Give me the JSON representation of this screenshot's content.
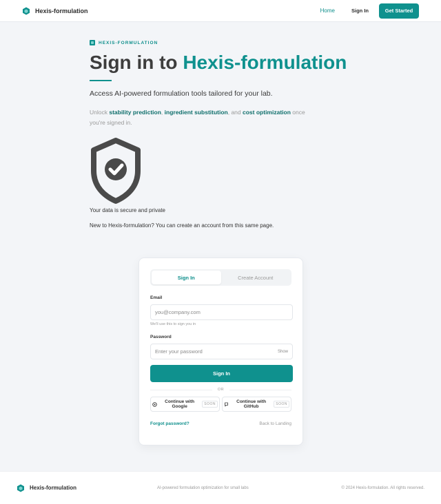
{
  "header": {
    "brand": "Hexis-formulation",
    "nav_home": "Home",
    "nav_signin": "Sign In",
    "nav_cta": "Get Started"
  },
  "hero": {
    "eyebrow": "HEXIS-FORMULATION",
    "title_prefix": "Sign in to ",
    "title_accent": "Hexis-formulation",
    "lead": "Access AI-powered formulation tools tailored for your lab.",
    "sub_1": "Unlock ",
    "sub_b1": "stability prediction",
    "sub_2": ", ",
    "sub_b2": "ingredient substitution",
    "sub_3": ", and ",
    "sub_b3": "cost optimization",
    "sub_4": " once you're signed in.",
    "secure_text": "Your data is secure and private",
    "new_to": "New to Hexis-formulation? You can create an account from this same page."
  },
  "card": {
    "tab_signin": "Sign In",
    "tab_create": "Create Account",
    "email_label": "Email",
    "email_placeholder": "you@company.com",
    "email_hint": "We'll use this to sign you in",
    "password_label": "Password",
    "password_placeholder": "Enter your password",
    "show_label": "Show",
    "submit_label": "Sign In",
    "or_label": "OR",
    "google_label": "Continue with Google",
    "github_label": "Continue with GitHub",
    "soon_label": "SOON",
    "forgot_label": "Forgot password?",
    "back_label": "Back to Landing"
  },
  "footer": {
    "brand": "Hexis-formulation",
    "tagline": "AI-powered formulation optimization for small labs",
    "copyright": "© 2024 Hexis-formulation. All rights reserved."
  },
  "colors": {
    "accent": "#0f918e",
    "background": "#f3f5f8",
    "text": "#3d3d3d"
  },
  "icons": {
    "brand": "hexagon-logo-icon",
    "shield": "shield-check-icon",
    "google": "google-icon",
    "github": "github-icon"
  }
}
